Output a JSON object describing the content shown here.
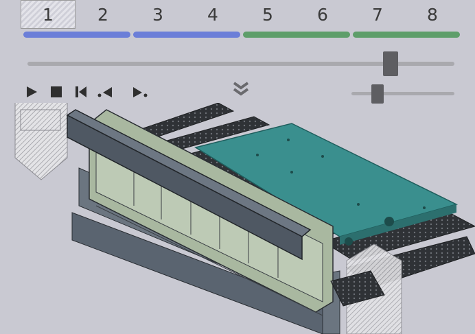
{
  "steps": [
    "1",
    "2",
    "3",
    "4",
    "5",
    "6",
    "7",
    "8"
  ],
  "active_step": 1,
  "progress_groups": [
    {
      "color": "#6b7ed8"
    },
    {
      "color": "#6b7ed8"
    },
    {
      "color": "#5e9e6a"
    },
    {
      "color": "#5e9e6a"
    }
  ],
  "timeline_slider": {
    "value": 0.94
  },
  "speed_slider": {
    "value": 0.25
  },
  "controls": [
    {
      "icon": "play-icon"
    },
    {
      "icon": "stop-icon"
    },
    {
      "icon": "skip-start-icon"
    },
    {
      "icon": "step-back-icon"
    },
    {
      "icon": "step-forward-icon"
    }
  ],
  "expand_icon": "double-chevron-down-icon",
  "colors": {
    "background": "#c9c9d2",
    "table_top": "#3a8f8e",
    "frame": "#a9b8a0",
    "beam": "#5a6470",
    "rail": "#2f3236"
  }
}
